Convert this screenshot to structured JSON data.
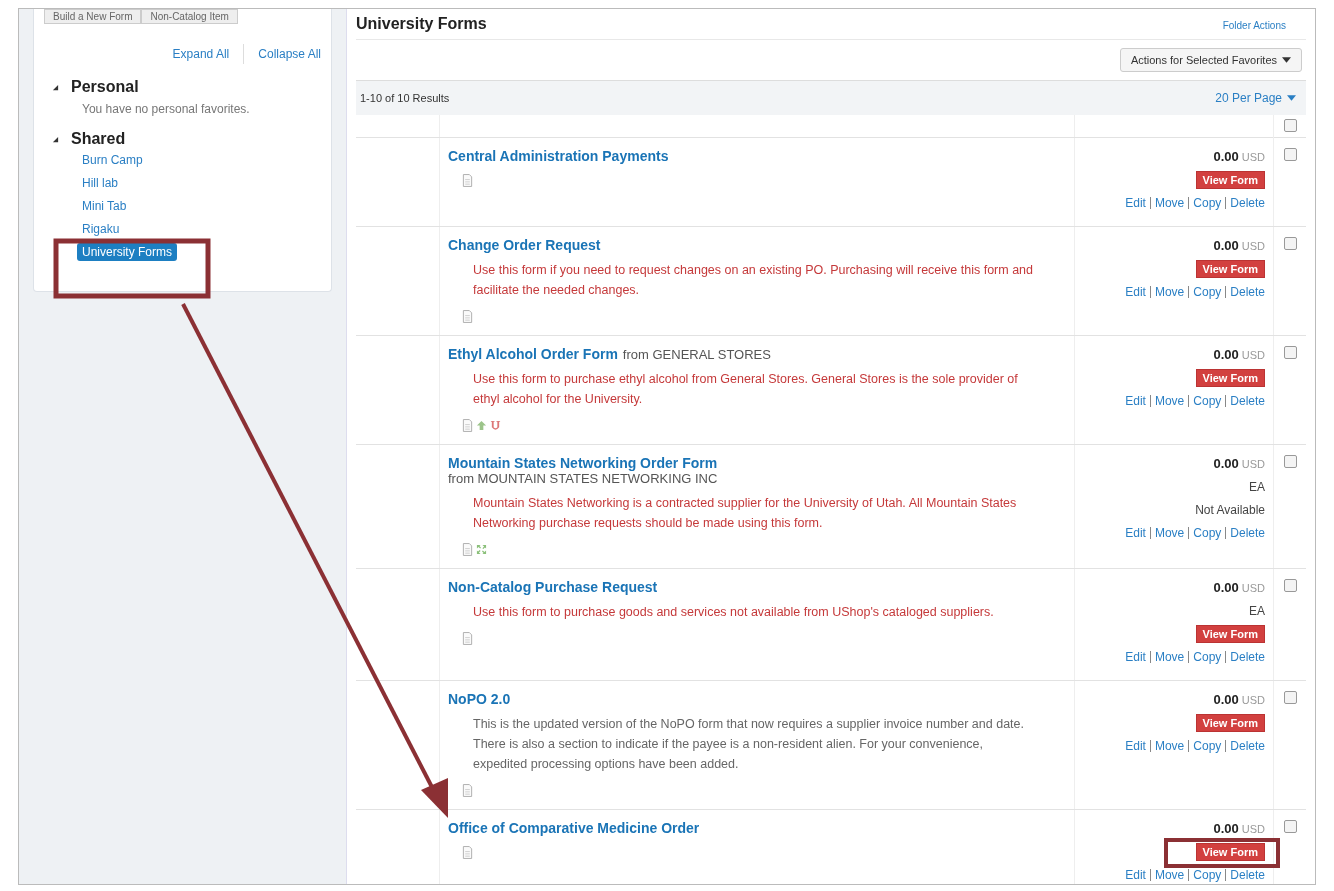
{
  "toolbar_buttons": [
    "Build a New Form",
    "Non-Catalog Item"
  ],
  "sidebar": {
    "expand_all": "Expand All",
    "collapse_all": "Collapse All",
    "sections": [
      {
        "title": "Personal",
        "expanded": true,
        "empty_text": "You have no personal favorites."
      },
      {
        "title": "Shared",
        "expanded": true,
        "items": [
          {
            "label": "Burn Camp",
            "selected": false
          },
          {
            "label": "Hill lab",
            "selected": false
          },
          {
            "label": "Mini Tab",
            "selected": false
          },
          {
            "label": "Rigaku",
            "selected": false
          },
          {
            "label": "University Forms",
            "selected": true
          }
        ]
      }
    ]
  },
  "main": {
    "title": "University Forms",
    "folder_actions": "Folder Actions",
    "bulk_actions": "Actions for Selected Favorites",
    "results": "1-10 of 10 Results",
    "per_page": "20 Per Page",
    "select_all_checked": false
  },
  "rows": [
    {
      "title": "Central Administration Payments",
      "price": "0.00",
      "currency": "USD",
      "view_form": "View Form",
      "actions": [
        "Edit",
        "Move",
        "Copy",
        "Delete"
      ],
      "icons": [
        {
          "kind": "document"
        }
      ],
      "checked": false
    },
    {
      "title": "Change Order Request",
      "description": "Use this form if you need to request changes on an existing PO. Purchasing will receive this form and facilitate the needed changes.",
      "color": "#c5393a",
      "price": "0.00",
      "currency": "USD",
      "view_form": "View Form",
      "actions": [
        "Edit",
        "Move",
        "Copy",
        "Delete"
      ],
      "icons": [
        {
          "kind": "document"
        }
      ],
      "checked": false
    },
    {
      "title": "Ethyl Alcohol Order Form",
      "supplier": "from GENERAL STORES",
      "description": "Use this form to purchase ethyl alcohol from General Stores. General Stores is the sole provider of ethyl alcohol for the University.",
      "color": "#c5393a",
      "price": "0.00",
      "currency": "USD",
      "view_form": "View Form",
      "actions": [
        "Edit",
        "Move",
        "Copy",
        "Delete"
      ],
      "icons": [
        {
          "kind": "document"
        },
        {
          "kind": "up"
        },
        {
          "kind": "logo"
        }
      ],
      "checked": false
    },
    {
      "title": "Mountain States Networking Order Form",
      "supplier": "from MOUNTAIN STATES NETWORKING INC",
      "supplier_newline": true,
      "description": "Mountain States Networking is a contracted supplier for the University of Utah. All Mountain States Networking purchase requests should be made using this form.",
      "color": "#c5393a",
      "price": "0.00",
      "currency": "USD",
      "unit": "EA",
      "availability": "Not Available",
      "actions": [
        "Edit",
        "Move",
        "Copy",
        "Delete"
      ],
      "icons": [
        {
          "kind": "document"
        },
        {
          "kind": "expand"
        }
      ],
      "checked": false
    },
    {
      "title": "Non-Catalog Purchase Request",
      "description": "Use this form to purchase goods and services not available from UShop's cataloged suppliers.",
      "color": "#c5393a",
      "price": "0.00",
      "currency": "USD",
      "unit": "EA",
      "view_form": "View Form",
      "actions": [
        "Edit",
        "Move",
        "Copy",
        "Delete"
      ],
      "icons": [
        {
          "kind": "document"
        }
      ],
      "checked": false
    },
    {
      "title": "NoPO 2.0",
      "description": "This is the updated version of the NoPO form that now requires a supplier invoice number and date. There is also a section to indicate if the payee is a non-resident alien. For your convenience, expedited processing options have been added.",
      "color": "#666666",
      "price": "0.00",
      "currency": "USD",
      "view_form": "View Form",
      "actions": [
        "Edit",
        "Move",
        "Copy",
        "Delete"
      ],
      "icons": [
        {
          "kind": "document"
        }
      ],
      "checked": false
    },
    {
      "title": "Office of Comparative Medicine Order",
      "price": "0.00",
      "currency": "USD",
      "view_form": "View Form",
      "actions": [
        "Edit",
        "Move",
        "Copy",
        "Delete"
      ],
      "icons": [
        {
          "kind": "document"
        }
      ],
      "checked": false
    }
  ]
}
